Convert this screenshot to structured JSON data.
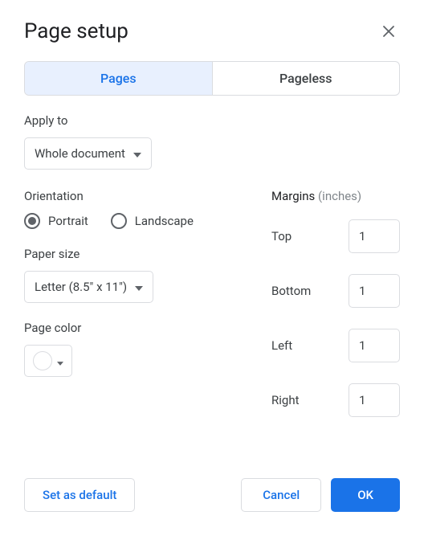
{
  "dialog": {
    "title": "Page setup"
  },
  "tabs": {
    "pages": "Pages",
    "pageless": "Pageless"
  },
  "applyTo": {
    "label": "Apply to",
    "value": "Whole document"
  },
  "orientation": {
    "label": "Orientation",
    "portrait": "Portrait",
    "landscape": "Landscape",
    "selected": "portrait"
  },
  "paperSize": {
    "label": "Paper size",
    "value": "Letter (8.5\" x 11\")"
  },
  "pageColor": {
    "label": "Page color",
    "value": "#ffffff"
  },
  "margins": {
    "label": "Margins",
    "unit": "(inches)",
    "top": {
      "label": "Top",
      "value": "1"
    },
    "bottom": {
      "label": "Bottom",
      "value": "1"
    },
    "left": {
      "label": "Left",
      "value": "1"
    },
    "right": {
      "label": "Right",
      "value": "1"
    }
  },
  "buttons": {
    "setDefault": "Set as default",
    "cancel": "Cancel",
    "ok": "OK"
  }
}
